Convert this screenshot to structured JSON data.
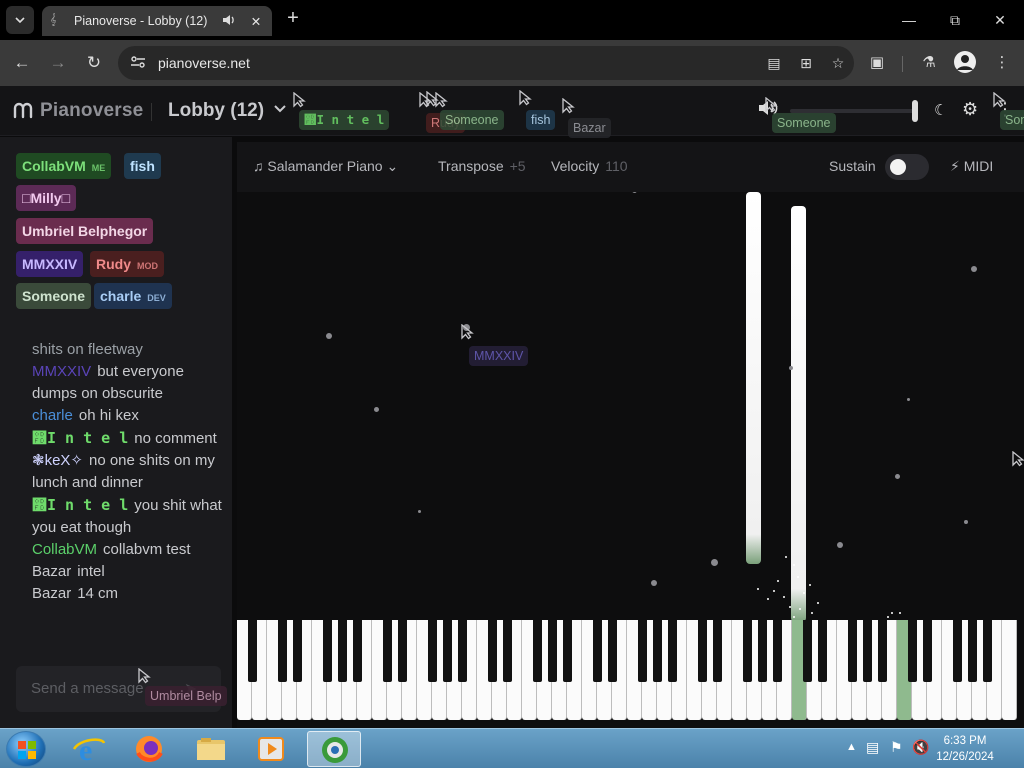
{
  "browser": {
    "tab_title": "Pianoverse - Lobby (12)",
    "url": "pianoverse.net"
  },
  "app": {
    "name": "Pianoverse",
    "room": "Lobby (12)"
  },
  "users": [
    {
      "name": "CollabVM",
      "tag": "ME",
      "bg": "#1f4a22",
      "fg": "#7de07b"
    },
    {
      "name": "fish",
      "tag": "",
      "bg": "#1f3a4f",
      "fg": "#bfe3ff"
    },
    {
      "name": "□Milly□",
      "tag": "",
      "bg": "#5c2a56",
      "fg": "#f2c9ee"
    },
    {
      "name": "Umbriel Belphegor",
      "tag": "",
      "bg": "#6a2c4e",
      "fg": "#f3d6e6"
    },
    {
      "name": "MMXXIV",
      "tag": "",
      "bg": "#35206a",
      "fg": "#c7b8ff"
    },
    {
      "name": "Rudy",
      "tag": "MOD",
      "bg": "#4a1f1f",
      "fg": "#f08a8a"
    },
    {
      "name": "Someone",
      "tag": "",
      "bg": "#3a4a3a",
      "fg": "#cfe3cf"
    },
    {
      "name": "charle",
      "tag": "DEV",
      "bg": "#1f3350",
      "fg": "#a9cdf5"
    }
  ],
  "chat": [
    {
      "name": "",
      "text": "shits on fleetway",
      "color": "#9aa0a6"
    },
    {
      "name": "MMXXIV",
      "text": "but everyone dumps on obscurite",
      "color": "#5a44b8"
    },
    {
      "name": "charle",
      "text": "oh hi kex",
      "color": "#4b8fd9"
    },
    {
      "name": "෽I n t e l",
      "text": "no comment",
      "color": "#6fdc6b"
    },
    {
      "name": "❃keX✧",
      "text": "no one shits on my lunch and dinner",
      "color": "#cfd3ff"
    },
    {
      "name": "෽I n t e l",
      "text": "you shit what you eat though",
      "color": "#6fdc6b"
    },
    {
      "name": "CollabVM",
      "text": "collabvm test",
      "color": "#5bd06a"
    },
    {
      "name": "Bazar",
      "text": "intel",
      "color": "#c9cace"
    },
    {
      "name": "Bazar",
      "text": "14 cm",
      "color": "#c9cace"
    }
  ],
  "chat_placeholder": "Send a message",
  "controls": {
    "instrument": "Salamander Piano",
    "transpose_label": "Transpose",
    "transpose_value": "+5",
    "velocity_label": "Velocity",
    "velocity_value": "110",
    "sustain_label": "Sustain",
    "sustain_on": false,
    "midi_label": "MIDI"
  },
  "cursors": [
    {
      "label": "෽I n t e l",
      "color": "#2f4a33",
      "fg": "#6fdc6b"
    },
    {
      "label": "Rudy",
      "color": "#4a1f1f",
      "fg": "#f08a8a"
    },
    {
      "label": "Someone",
      "color": "#2e4a35",
      "fg": "#9fd09f"
    },
    {
      "label": "fish",
      "color": "#1f3a4f",
      "fg": "#bfe3ff"
    },
    {
      "label": "Bazar",
      "color": "#26272b",
      "fg": "#a0a2a8"
    },
    {
      "label": "Someone",
      "color": "#2e4a35",
      "fg": "#9fd09f"
    },
    {
      "label": "Som",
      "color": "#2e4a35",
      "fg": "#9fd09f"
    },
    {
      "label": "MMXXIV",
      "color": "#26203a",
      "fg": "#6d62c4"
    },
    {
      "label": "Umbriel Belp",
      "color": "#3a2030",
      "fg": "#c89db5"
    }
  ],
  "taskbar": {
    "time": "6:33 PM",
    "date": "12/26/2024"
  }
}
